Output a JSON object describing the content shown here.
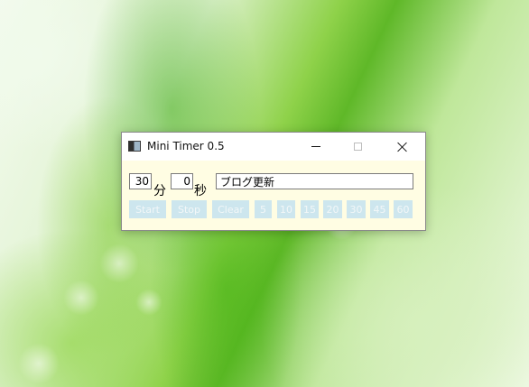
{
  "window": {
    "title": "Mini Timer 0.5",
    "icon": "app-icon",
    "controls": [
      "minimize",
      "maximize",
      "close"
    ]
  },
  "timer": {
    "minutes_value": "30",
    "minutes_unit": "分",
    "seconds_value": "0",
    "seconds_unit": "秒",
    "task_value": "ブログ更新"
  },
  "buttons": {
    "start": "Start",
    "stop": "Stop",
    "clear": "Clear",
    "presets": [
      "5",
      "10",
      "15",
      "20",
      "30",
      "45",
      "60"
    ]
  },
  "colors": {
    "window_bg": "#fffde3",
    "button_bg": "#cde6ee",
    "button_text": "#f2f7f8"
  }
}
